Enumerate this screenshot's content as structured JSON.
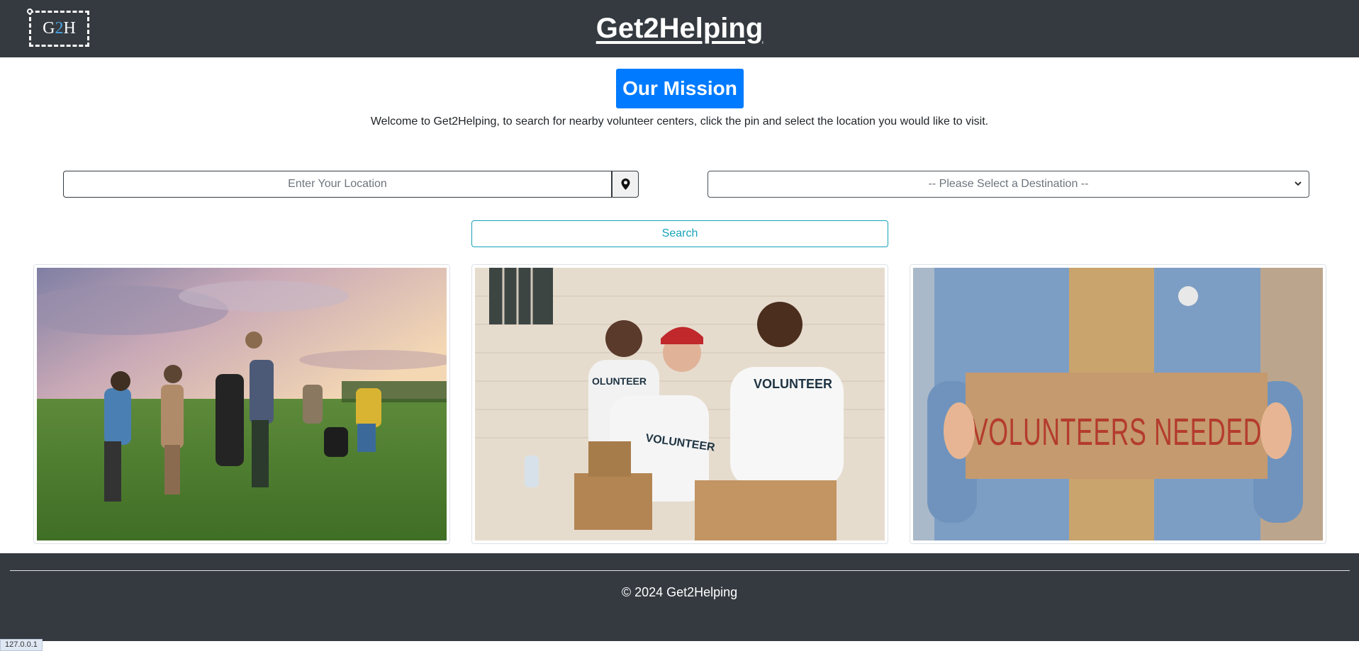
{
  "header": {
    "logo_text_left": "G",
    "logo_text_mid": "2",
    "logo_text_right": "H",
    "title": "Get2Helping"
  },
  "mission": {
    "button_label": "Our Mission",
    "welcome_text": "Welcome to Get2Helping, to search for nearby volunteer centers, click the pin and select the location you would like to visit."
  },
  "search_form": {
    "location_placeholder": "Enter Your Location",
    "location_value": "",
    "pin_icon": "map-pin-icon",
    "destination_selected": "-- Please Select a Destination --",
    "search_label": "Search"
  },
  "cards": [
    {
      "description": "volunteers-cleaning-field-photo"
    },
    {
      "description": "volunteers-handing-out-water-photo"
    },
    {
      "description": "volunteers-needed-sign-photo"
    }
  ],
  "footer": {
    "copyright": "© 2024 Get2Helping"
  },
  "status_bar": {
    "url": "127.0.0.1"
  },
  "colors": {
    "navbar": "#343a40",
    "primary": "#007bff",
    "info": "#17a2b8"
  }
}
